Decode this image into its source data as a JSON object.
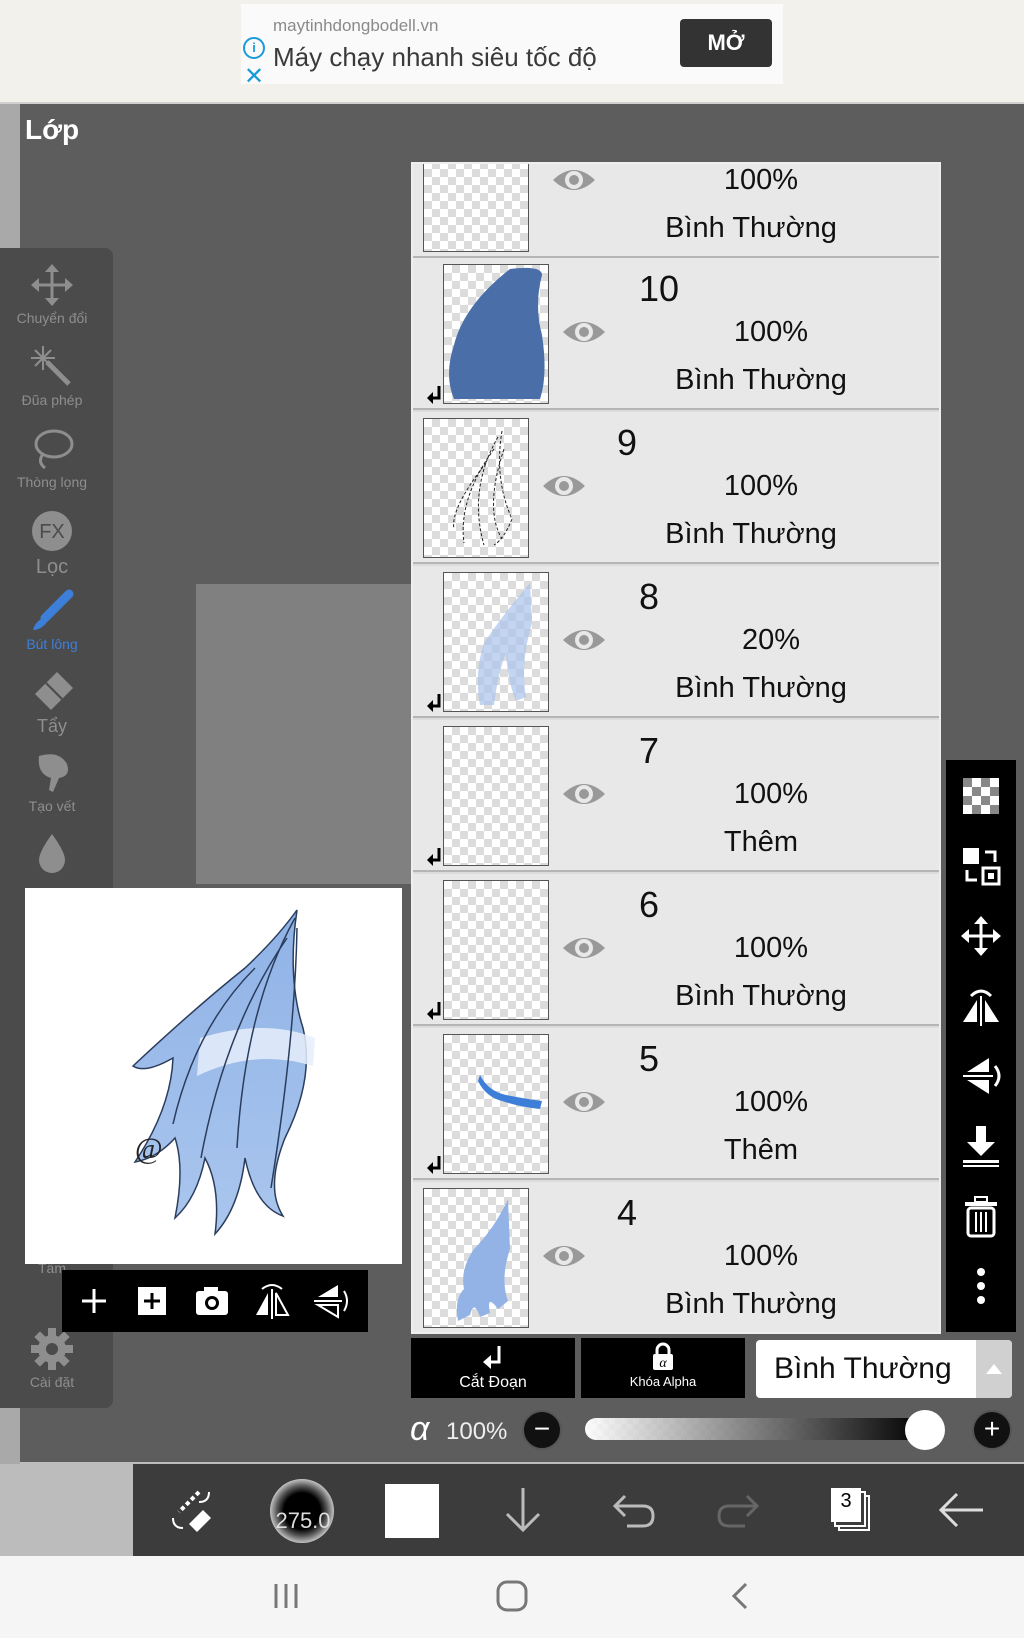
{
  "ad": {
    "url": "maytinhdongbodell.vn",
    "title": "Máy chạy nhanh siêu tốc độ",
    "open_label": "MỞ",
    "info_glyph": "i",
    "close_glyph": "✕"
  },
  "panel": {
    "title": "Lớp"
  },
  "left_toolbar": {
    "items": [
      {
        "label": "Chuyển đổi",
        "icon": "move-icon"
      },
      {
        "label": "Đũa phép",
        "icon": "magic-wand-icon"
      },
      {
        "label": "Thòng lọng",
        "icon": "lasso-icon"
      },
      {
        "label": "Lọc",
        "icon": "fx-icon",
        "glyph": "FX"
      },
      {
        "label": "Bút lông",
        "icon": "brush-icon",
        "active": true
      },
      {
        "label": "Tẩy",
        "icon": "eraser-icon"
      },
      {
        "label": "Tạo vết",
        "icon": "smudge-icon"
      },
      {
        "label": "",
        "icon": "drop-icon"
      },
      {
        "label": "Tấm",
        "icon": "canvas-icon"
      },
      {
        "label": "Cài đặt",
        "icon": "gear-icon"
      }
    ]
  },
  "layers": [
    {
      "number": "",
      "opacity": "100%",
      "mode": "Bình Thường",
      "clipped": false
    },
    {
      "number": "10",
      "opacity": "100%",
      "mode": "Bình Thường",
      "clipped": true
    },
    {
      "number": "9",
      "opacity": "100%",
      "mode": "Bình Thường",
      "clipped": false
    },
    {
      "number": "8",
      "opacity": "20%",
      "mode": "Bình Thường",
      "clipped": true
    },
    {
      "number": "7",
      "opacity": "100%",
      "mode": "Thêm",
      "clipped": true
    },
    {
      "number": "6",
      "opacity": "100%",
      "mode": "Bình Thường",
      "clipped": true
    },
    {
      "number": "5",
      "opacity": "100%",
      "mode": "Thêm",
      "clipped": true
    },
    {
      "number": "4",
      "opacity": "100%",
      "mode": "Bình Thường",
      "clipped": false
    }
  ],
  "layer_actions": {
    "clip_label": "Cắt Đoạn",
    "alpha_lock_label": "Khóa Alpha",
    "blend_mode": "Bình Thường"
  },
  "opacity": {
    "symbol": "α",
    "value": "100%",
    "level": 1.0
  },
  "bottom_toolbar": {
    "brush_size": "275.0",
    "layer_count": "3",
    "color": "#ffffff"
  },
  "colors": {
    "accent": "#3d7fd8",
    "layer_blue": "#4a6fa8",
    "panel_bg": "#5d5d5d"
  }
}
